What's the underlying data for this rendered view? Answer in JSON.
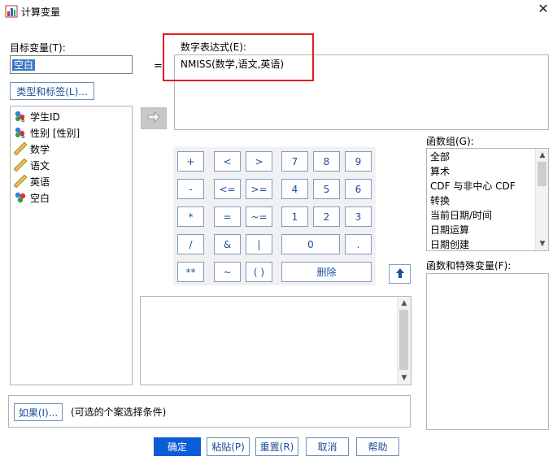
{
  "window": {
    "title": "计算变量",
    "close_glyph": "✕"
  },
  "target": {
    "label": "目标变量(T):",
    "value": "空白",
    "type_label_button": "类型和标签(L)..."
  },
  "equals": "=",
  "variables": [
    {
      "label": "学生ID",
      "icon": "nominal-icon"
    },
    {
      "label": "性别 [性别]",
      "icon": "nominal-icon"
    },
    {
      "label": "数学",
      "icon": "scale-ruler-icon"
    },
    {
      "label": "语文",
      "icon": "scale-ruler-icon"
    },
    {
      "label": "英语",
      "icon": "scale-ruler-icon"
    },
    {
      "label": "空白",
      "icon": "nominal-balls-icon"
    }
  ],
  "expression": {
    "label": "数字表达式(E):",
    "value": "NMISS(数学,语文,英语)"
  },
  "keypad": {
    "row1": [
      "+",
      "<",
      ">",
      "7",
      "8",
      "9"
    ],
    "row2": [
      "-",
      "<=",
      ">=",
      "4",
      "5",
      "6"
    ],
    "row3": [
      "*",
      "=",
      "~=",
      "1",
      "2",
      "3"
    ],
    "row4": [
      "/",
      "&",
      "|",
      "0",
      "."
    ],
    "row5": [
      "**",
      "~",
      "( )",
      "删除"
    ]
  },
  "function_group": {
    "label": "函数组(G):",
    "items": [
      "全部",
      "算术",
      "CDF 与非中心 CDF",
      "转换",
      "当前日期/时间",
      "日期运算",
      "日期创建"
    ]
  },
  "special_vars": {
    "label": "函数和特殊变量(F):"
  },
  "if_section": {
    "button": "如果(I)...",
    "note": "(可选的个案选择条件)"
  },
  "footer": {
    "ok": "确定",
    "paste": "粘贴(P)",
    "reset": "重置(R)",
    "cancel": "取消",
    "help": "帮助"
  },
  "colors": {
    "accent": "#0b5cd7",
    "highlight_border": "#e31b1b",
    "link_text": "#1a4f99"
  }
}
